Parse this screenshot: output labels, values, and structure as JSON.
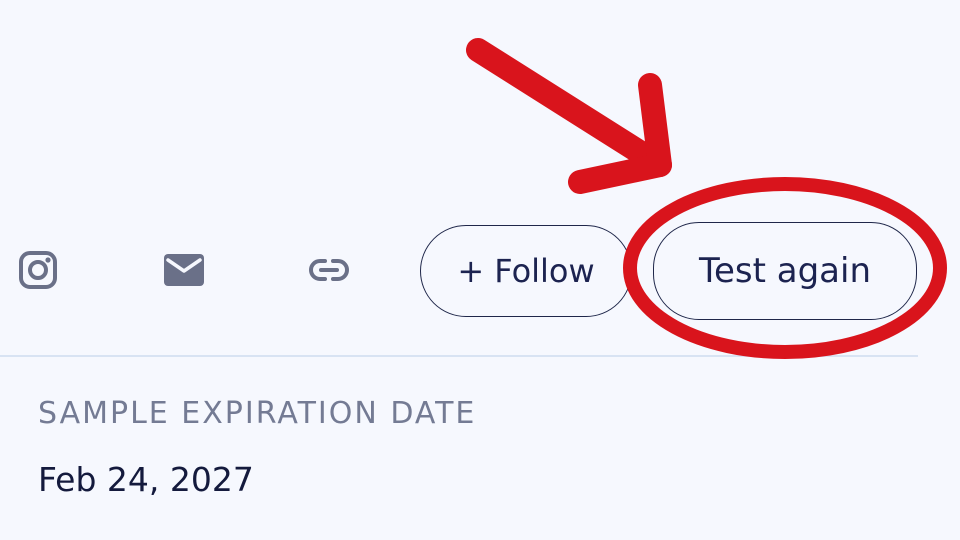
{
  "social": {
    "icons": [
      "instagram-icon",
      "mail-icon",
      "link-icon"
    ],
    "icon_color": "#6a7088"
  },
  "actions": {
    "follow_label": "+ Follow",
    "test_again_label": "Test again"
  },
  "details": {
    "expiration_label": "SAMPLE EXPIRATION DATE",
    "expiration_value": "Feb 24, 2027"
  },
  "annotation": {
    "color": "#d9141c",
    "marks": [
      "arrow",
      "circle"
    ]
  }
}
